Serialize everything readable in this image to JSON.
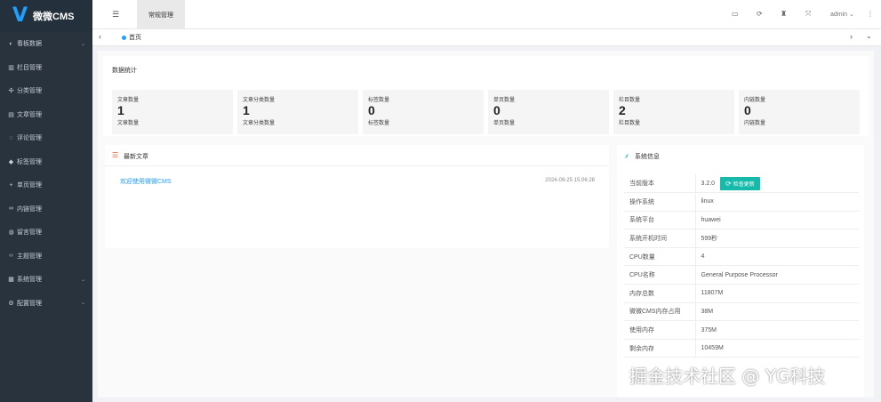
{
  "app": {
    "logo_mark": "V",
    "logo_text": "微微CMS"
  },
  "sidebar": {
    "items": [
      {
        "label": "看板数据",
        "icon": "dashboard-icon",
        "has_arrow": true
      },
      {
        "label": "栏目管理",
        "icon": "columns-icon",
        "has_arrow": false
      },
      {
        "label": "分类管理",
        "icon": "category-icon",
        "has_arrow": false
      },
      {
        "label": "文章管理",
        "icon": "article-icon",
        "has_arrow": false
      },
      {
        "label": "评论管理",
        "icon": "comment-icon",
        "has_arrow": false
      },
      {
        "label": "标签管理",
        "icon": "tag-icon",
        "has_arrow": false
      },
      {
        "label": "单页管理",
        "icon": "page-icon",
        "has_arrow": false
      },
      {
        "label": "内链管理",
        "icon": "link-icon",
        "has_arrow": false
      },
      {
        "label": "留言管理",
        "icon": "message-icon",
        "has_arrow": false
      },
      {
        "label": "主题管理",
        "icon": "code-icon",
        "has_arrow": false
      },
      {
        "label": "系统管理",
        "icon": "system-icon",
        "has_arrow": true
      },
      {
        "label": "配置管理",
        "icon": "config-icon",
        "has_arrow": true
      }
    ]
  },
  "header": {
    "tab_label": "常规管理",
    "user": "admin",
    "icons": [
      "monitor-icon",
      "refresh-icon",
      "trash-icon",
      "fullscreen-icon"
    ]
  },
  "tabsbar": {
    "home_tab": "首页"
  },
  "stats": {
    "title": "数据统计",
    "boxes": [
      {
        "title": "文章数量",
        "value": "1",
        "sub": "文章数量"
      },
      {
        "title": "文章分类数量",
        "value": "1",
        "sub": "文章分类数量"
      },
      {
        "title": "标签数量",
        "value": "0",
        "sub": "标签数量"
      },
      {
        "title": "单页数量",
        "value": "0",
        "sub": "单页数量"
      },
      {
        "title": "栏目数量",
        "value": "2",
        "sub": "栏目数量"
      },
      {
        "title": "内链数量",
        "value": "0",
        "sub": "内链数量"
      }
    ]
  },
  "articles": {
    "title": "最新文章",
    "items": [
      {
        "title": "欢迎使用微微CMS",
        "date": "2024-09-25 15:06:28"
      }
    ]
  },
  "system": {
    "title": "系统信息",
    "check_update_label": "检查更新",
    "rows": [
      {
        "key": "当前版本",
        "value": "3.2.0"
      },
      {
        "key": "操作系统",
        "value": "linux"
      },
      {
        "key": "系统平台",
        "value": "huawei"
      },
      {
        "key": "系统开机时间",
        "value": "599秒"
      },
      {
        "key": "CPU数量",
        "value": "4"
      },
      {
        "key": "CPU名称",
        "value": "General Purpose Processor"
      },
      {
        "key": "内存总数",
        "value": "11807M"
      },
      {
        "key": "微微CMS内存占用",
        "value": "38M"
      },
      {
        "key": "使用内存",
        "value": "375M"
      },
      {
        "key": "剩余内存",
        "value": "10459M"
      }
    ]
  },
  "watermark": "掘金技术社区 @ YG科技",
  "colors": {
    "sidebar_bg": "#28333e",
    "accent_blue": "#1e9fff",
    "accent_teal": "#16baaa",
    "accent_orange": "#f25a2b"
  }
}
